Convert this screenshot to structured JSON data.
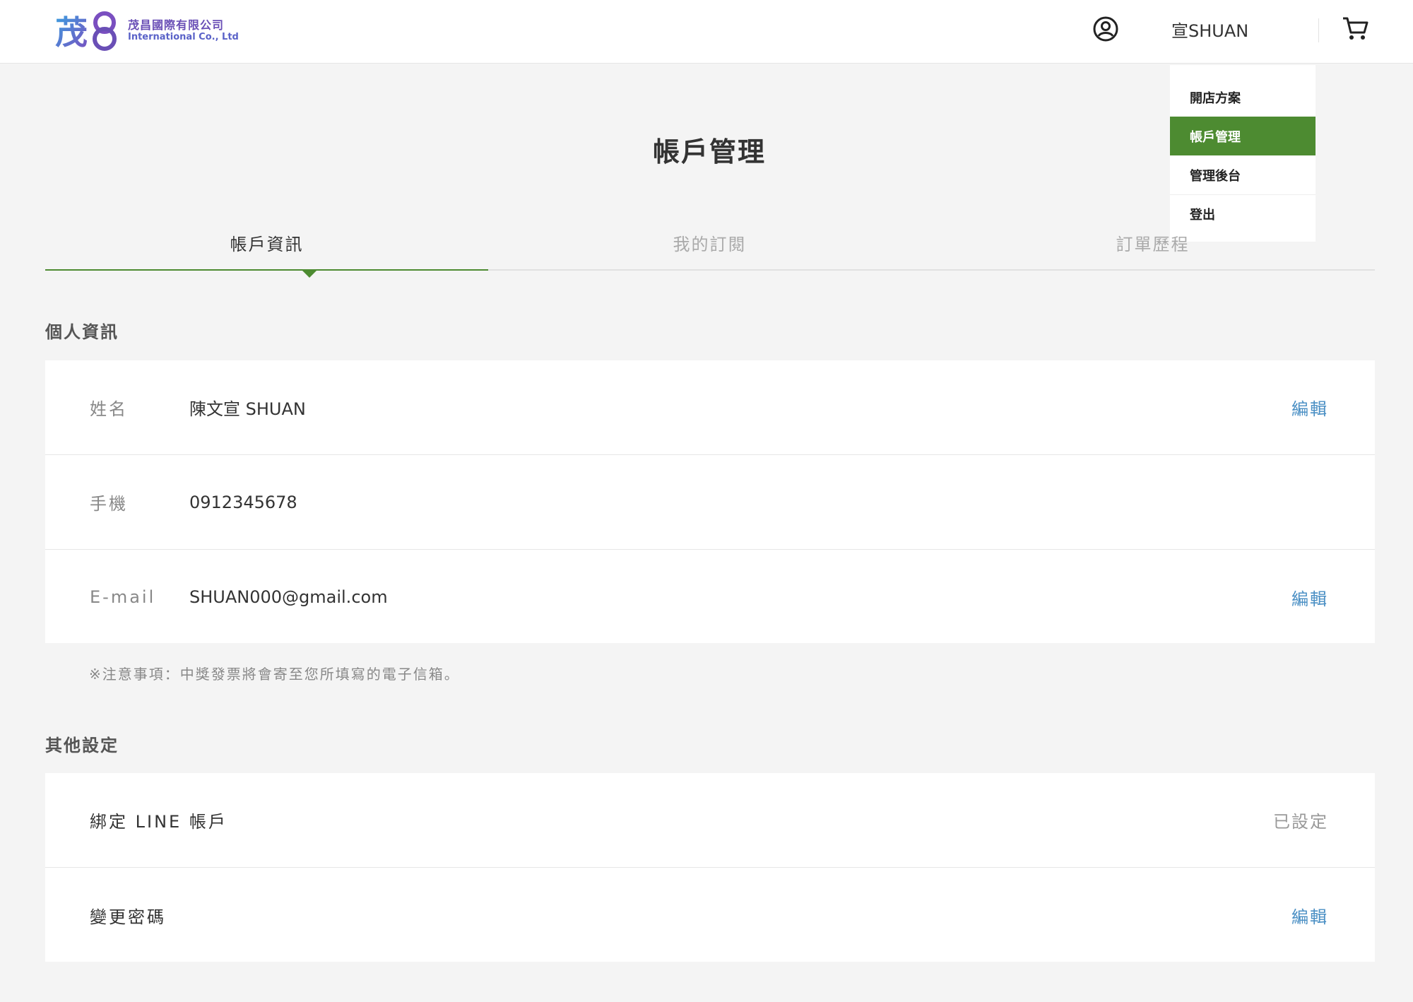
{
  "brand": {
    "mark": "茂8",
    "name_zh": "茂昌國際有限公司",
    "name_en": "International Co., Ltd"
  },
  "header": {
    "user_name": "宣SHUAN",
    "icons": [
      "user-circle-icon",
      "cart-icon"
    ]
  },
  "dropdown": {
    "items": [
      {
        "label": "開店方案",
        "active": false
      },
      {
        "label": "帳戶管理",
        "active": true
      },
      {
        "label": "管理後台",
        "active": false
      },
      {
        "label": "登出",
        "active": false
      }
    ]
  },
  "page": {
    "title": "帳戶管理"
  },
  "tabs": [
    {
      "label": "帳戶資訊",
      "active": true
    },
    {
      "label": "我的訂閱",
      "active": false
    },
    {
      "label": "訂單歷程",
      "active": false
    }
  ],
  "personal": {
    "section_title": "個人資訊",
    "rows": [
      {
        "label": "姓名",
        "value": "陳文宣 SHUAN",
        "action": "編輯"
      },
      {
        "label": "手機",
        "value": "0912345678",
        "action": ""
      },
      {
        "label": "E-mail",
        "value": "SHUAN000@gmail.com",
        "action": "編輯"
      }
    ],
    "note": "※注意事項：中獎發票將會寄至您所填寫的電子信箱。"
  },
  "other": {
    "section_title": "其他設定",
    "rows": [
      {
        "label": "綁定 LINE 帳戶",
        "status": "已設定"
      },
      {
        "label": "變更密碼",
        "action": "編輯"
      }
    ]
  },
  "colors": {
    "accent_green": "#4d8b31",
    "link_blue": "#4a8fc4",
    "background": "#f4f4f4"
  }
}
